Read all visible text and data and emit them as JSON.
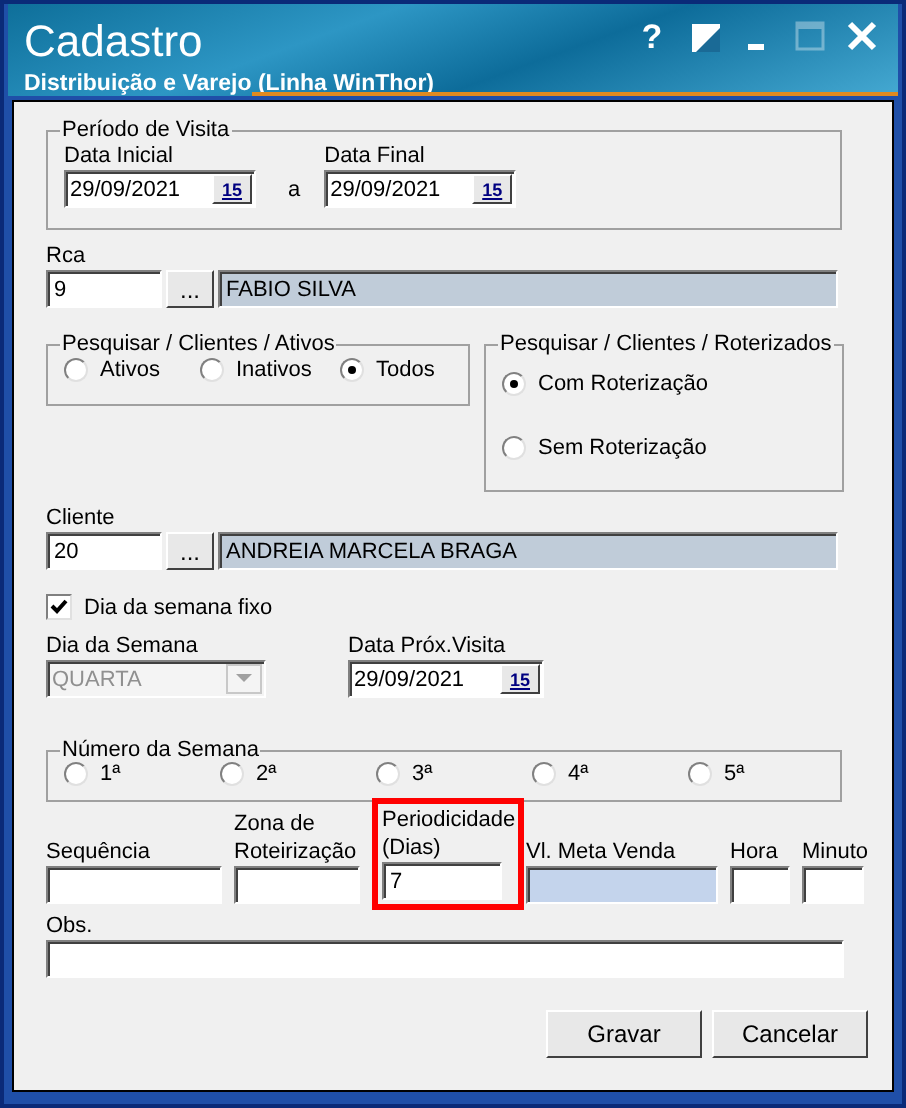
{
  "window": {
    "title": "Cadastro",
    "subtitle": "Distribuição e Varejo (Linha WinThor)"
  },
  "title_buttons": [
    {
      "kind": "help",
      "label": "?",
      "disabled": false
    },
    {
      "kind": "theme",
      "disabled": false
    },
    {
      "kind": "minimize",
      "disabled": false
    },
    {
      "kind": "maximize",
      "disabled": true
    },
    {
      "kind": "close",
      "disabled": false
    }
  ],
  "periodo": {
    "title": "Período de Visita",
    "start_label": "Data Inicial",
    "start_value": "29/09/2021",
    "start_calendar": "15",
    "separator": "a",
    "end_label": "Data Final",
    "end_value": "29/09/2021",
    "end_calendar": "15"
  },
  "rca": {
    "label": "Rca",
    "code": "9",
    "lookup": "...",
    "name": "FABIO SILVA"
  },
  "ativos": {
    "title": "Pesquisar / Clientes / Ativos",
    "options": [
      {
        "label": "Ativos",
        "selected": false
      },
      {
        "label": "Inativos",
        "selected": false
      },
      {
        "label": "Todos",
        "selected": true
      }
    ]
  },
  "roterizados": {
    "title": "Pesquisar / Clientes / Roterizados",
    "options": [
      {
        "label": "Com Roterização",
        "selected": true
      },
      {
        "label": "Sem Roterização",
        "selected": false
      }
    ]
  },
  "cliente": {
    "label": "Cliente",
    "code": "20",
    "lookup": "...",
    "name": "ANDREIA MARCELA BRAGA"
  },
  "dia_fixo": {
    "label": "Dia da semana fixo",
    "checked": true
  },
  "dia_semana": {
    "label": "Dia da Semana",
    "value": "QUARTA",
    "disabled": true
  },
  "proxima_visita": {
    "label": "Data Próx.Visita",
    "value": "29/09/2021",
    "calendar": "15"
  },
  "numero_semana": {
    "title": "Número da Semana",
    "options": [
      {
        "label": "1ª",
        "selected": false
      },
      {
        "label": "2ª",
        "selected": false
      },
      {
        "label": "3ª",
        "selected": false
      },
      {
        "label": "4ª",
        "selected": false
      },
      {
        "label": "5ª",
        "selected": false
      }
    ]
  },
  "fields": [
    {
      "label": "Sequência",
      "kind": "text",
      "highlighted": false
    },
    {
      "label": "Zona de Roteirização",
      "kind": "text",
      "highlighted": false
    },
    {
      "label": "Periodicidade (Dias)",
      "value": "7",
      "kind": "text",
      "highlighted": true
    },
    {
      "label": "Vl. Meta Venda",
      "kind": "shaded",
      "highlighted": false
    },
    {
      "label": "Hora",
      "kind": "text",
      "highlighted": false
    },
    {
      "label": "Minuto",
      "kind": "text",
      "highlighted": false
    }
  ],
  "obs": {
    "label": "Obs."
  },
  "buttons": [
    {
      "label": "Gravar"
    },
    {
      "label": "Cancelar"
    }
  ]
}
